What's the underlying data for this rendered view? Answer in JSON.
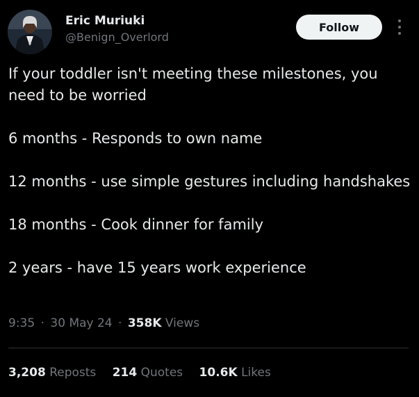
{
  "author": {
    "name": "Eric Muriuki",
    "handle": "@Benign_Overlord"
  },
  "follow_button": {
    "label": "Follow"
  },
  "more_menu": {
    "icon": "more-icon"
  },
  "tweet": {
    "paragraphs": [
      "If your toddler isn't meeting these milestones, you need to be worried",
      "6 months - Responds to own name",
      "12 months - use simple gestures including handshakes",
      "18 months - Cook dinner for family",
      "2 years - have 15 years work experience"
    ]
  },
  "meta": {
    "time": "9:35",
    "date": "30 May 24",
    "views_count": "358K",
    "views_label": "Views",
    "separator": "·"
  },
  "stats": {
    "reposts_count": "3,208",
    "reposts_label": "Reposts",
    "quotes_count": "214",
    "quotes_label": "Quotes",
    "likes_count": "10.6K",
    "likes_label": "Likes"
  },
  "colors": {
    "background": "#000000",
    "text_primary": "#e7e9ea",
    "text_secondary": "#71767b",
    "button_bg": "#eff3f4",
    "divider": "#2f3336"
  }
}
